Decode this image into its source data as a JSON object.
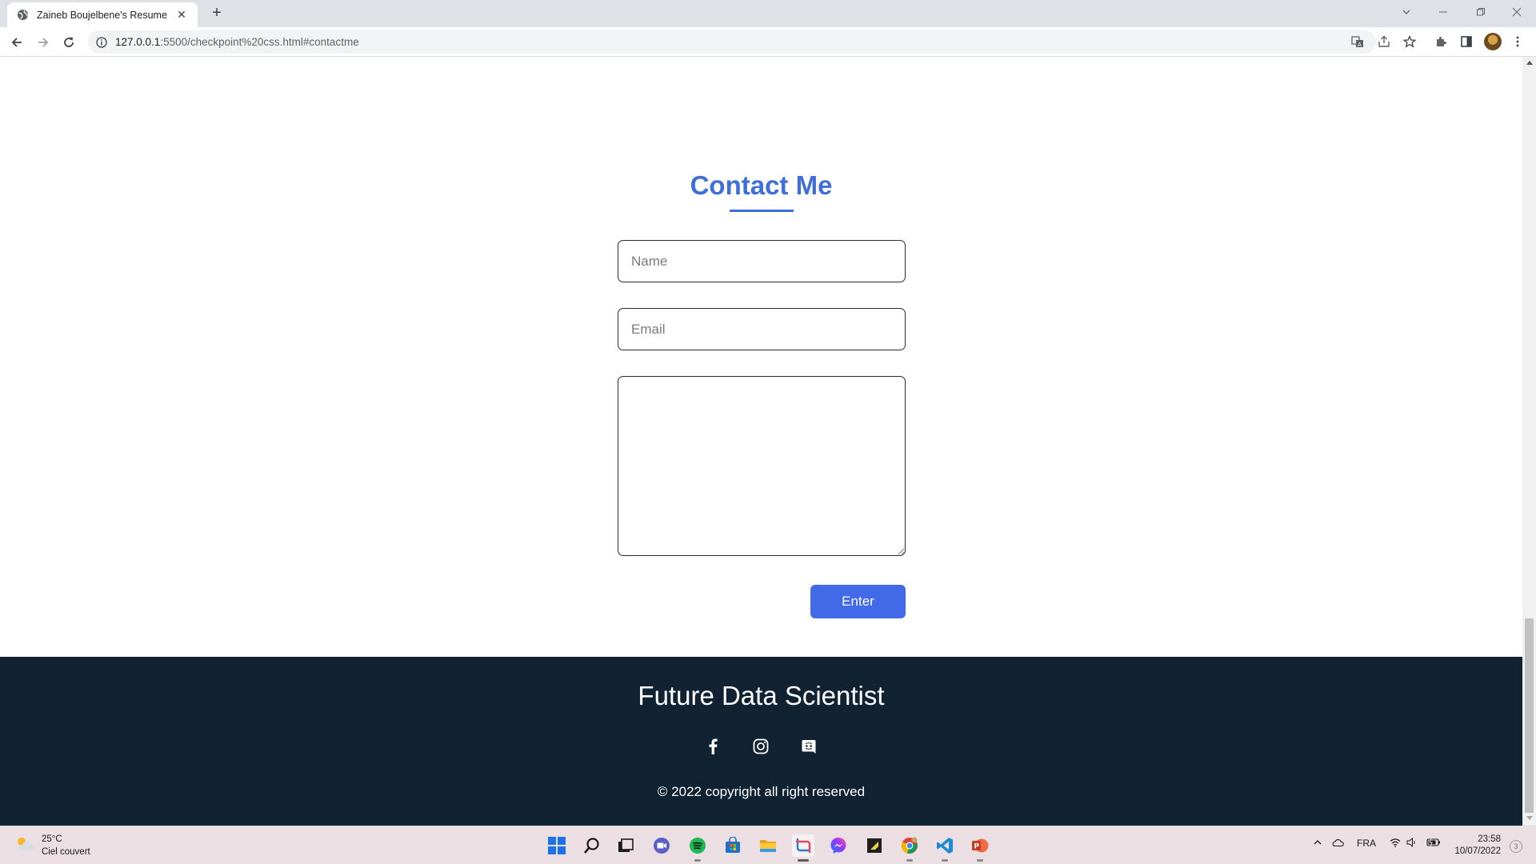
{
  "browser": {
    "tab_title": "Zaineb Boujelbene's Resume",
    "tab_close": "✕",
    "new_tab": "+",
    "url_host": "127.0.0.1",
    "url_rest": ":5500/checkpoint%20css.html#contactme"
  },
  "contact": {
    "title": "Contact Me",
    "name_placeholder": "Name",
    "email_placeholder": "Email",
    "message_placeholder": "",
    "submit_label": "Enter"
  },
  "footer": {
    "title": "Future Data Scientist",
    "social_icons": [
      "facebook-icon",
      "instagram-icon",
      "discord-icon"
    ],
    "copyright": "© 2022 copyright all right reserved"
  },
  "taskbar": {
    "weather_temp": "25°C",
    "weather_desc": "Ciel couvert",
    "language": "FRA",
    "time": "23:58",
    "date": "10/07/2022",
    "notification_count": "3"
  },
  "colors": {
    "accent": "#3f6ed8",
    "button": "#4169e8",
    "footer_bg": "#112233"
  }
}
